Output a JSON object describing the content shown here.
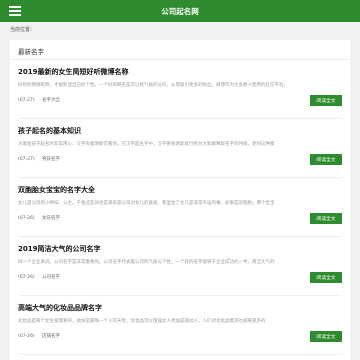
{
  "header": {
    "title": "公司起名网",
    "menu_icon": "menu-icon"
  },
  "breadcrumb": "当前位置：",
  "section": {
    "title": "最新名字"
  },
  "articles": [
    {
      "title": "2019最新的女生简短好听微博名称",
      "excerpt": "好听的网络昵称，才能彰显自己的个性。一个好的网名是可以给气质的分的，从而吸引更多的粉丝。微博作为大多数人使用的社交平台，",
      "date": "(07-27)",
      "category": "名字大全",
      "button": "阅读全文"
    },
    {
      "title": "孩子起名的基本知识",
      "excerpt": "大家给孩子起名时非常用心，汉字有着明即可看到，在汉字起名字中，汉字要有明即就行给为大家解释取名字的时候，老师这种都",
      "date": "(07-27)",
      "category": "男孩名字",
      "button": "阅读全文"
    },
    {
      "title": "双胞胎女宝宝的名字大全",
      "excerpt": "女儿是父母的小棉袄，公主。千金这些词也是来形容父母对女儿的喜爱。家里生了女儿是非常幸运的事，如果是双胞胎，两个宝宝",
      "date": "(07-26)",
      "category": "女孩名字",
      "button": "阅读全文"
    },
    {
      "title": "2019简洁大气的公司名字",
      "excerpt": "同一个企业来说，公司名字是非常重要的。公司名字代表着公司的气质与个性，一个好的名字能够于企业成功的一半。简洁大气的",
      "date": "(07-26)",
      "category": "公司名字",
      "button": "阅读全文"
    },
    {
      "title": "高端大气的化妆品品牌名字",
      "excerpt": "化妆品是每个女生很需要的，妆扮是最每一个人的天性，化妆品可以增强女人更加美丽动人，人们对化妆品需求也越来越多的",
      "date": "(07-26)",
      "category": "店铺名字",
      "button": "阅读全文"
    }
  ]
}
